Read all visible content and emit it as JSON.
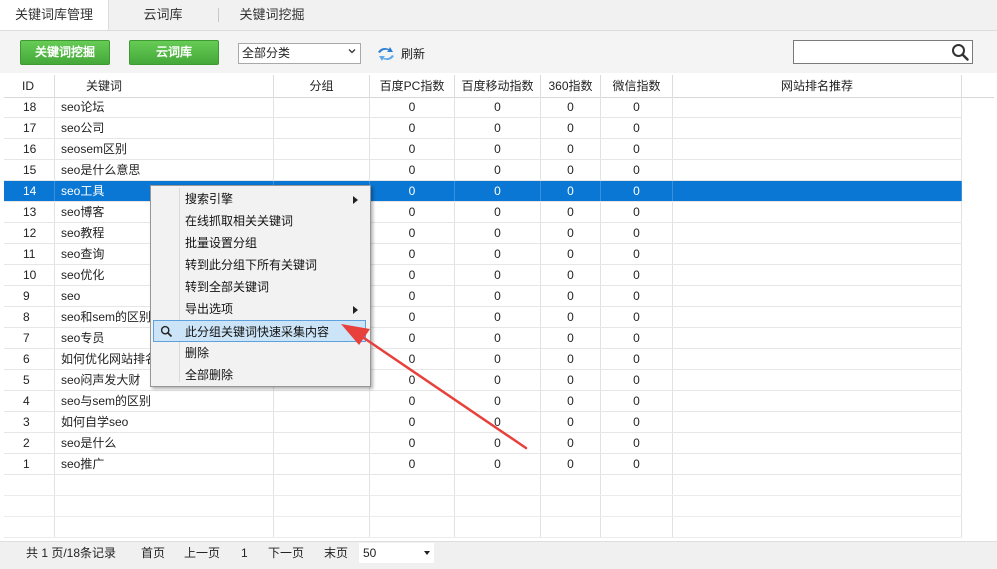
{
  "tabs": [
    "关键词库管理",
    "云词库",
    "关键词挖掘"
  ],
  "toolbar": {
    "btn_mining": "关键词挖掘",
    "btn_cloud": "云词库",
    "category_select": "全部分类",
    "refresh": "刷新",
    "search_value": ""
  },
  "columns": [
    "ID",
    "关键词",
    "分组",
    "百度PC指数",
    "百度移动指数",
    "360指数",
    "微信指数",
    "网站排名推荐"
  ],
  "rows": [
    {
      "id": "18",
      "kw": "seo论坛",
      "grp": "",
      "pc": "0",
      "mob": "0",
      "s360": "0",
      "wx": "0",
      "rec": ""
    },
    {
      "id": "17",
      "kw": "seo公司",
      "grp": "",
      "pc": "0",
      "mob": "0",
      "s360": "0",
      "wx": "0",
      "rec": ""
    },
    {
      "id": "16",
      "kw": "seosem区别",
      "grp": "",
      "pc": "0",
      "mob": "0",
      "s360": "0",
      "wx": "0",
      "rec": ""
    },
    {
      "id": "15",
      "kw": "seo是什么意思",
      "grp": "",
      "pc": "0",
      "mob": "0",
      "s360": "0",
      "wx": "0",
      "rec": ""
    },
    {
      "id": "14",
      "kw": "seo工具",
      "grp": "",
      "pc": "0",
      "mob": "0",
      "s360": "0",
      "wx": "0",
      "rec": "",
      "selected": true
    },
    {
      "id": "13",
      "kw": "seo博客",
      "grp": "",
      "pc": "0",
      "mob": "0",
      "s360": "0",
      "wx": "0",
      "rec": ""
    },
    {
      "id": "12",
      "kw": "seo教程",
      "grp": "",
      "pc": "0",
      "mob": "0",
      "s360": "0",
      "wx": "0",
      "rec": ""
    },
    {
      "id": "11",
      "kw": "seo查询",
      "grp": "",
      "pc": "0",
      "mob": "0",
      "s360": "0",
      "wx": "0",
      "rec": ""
    },
    {
      "id": "10",
      "kw": "seo优化",
      "grp": "",
      "pc": "0",
      "mob": "0",
      "s360": "0",
      "wx": "0",
      "rec": ""
    },
    {
      "id": "9",
      "kw": "seo",
      "grp": "",
      "pc": "0",
      "mob": "0",
      "s360": "0",
      "wx": "0",
      "rec": ""
    },
    {
      "id": "8",
      "kw": "seo和sem的区别",
      "grp": "",
      "pc": "0",
      "mob": "0",
      "s360": "0",
      "wx": "0",
      "rec": ""
    },
    {
      "id": "7",
      "kw": "seo专员",
      "grp": "",
      "pc": "0",
      "mob": "0",
      "s360": "0",
      "wx": "0",
      "rec": ""
    },
    {
      "id": "6",
      "kw": "如何优化网站排名",
      "grp": "",
      "pc": "0",
      "mob": "0",
      "s360": "0",
      "wx": "0",
      "rec": ""
    },
    {
      "id": "5",
      "kw": "seo闷声发大财",
      "grp": "",
      "pc": "0",
      "mob": "0",
      "s360": "0",
      "wx": "0",
      "rec": ""
    },
    {
      "id": "4",
      "kw": "seo与sem的区别",
      "grp": "",
      "pc": "0",
      "mob": "0",
      "s360": "0",
      "wx": "0",
      "rec": ""
    },
    {
      "id": "3",
      "kw": "如何自学seo",
      "grp": "",
      "pc": "0",
      "mob": "0",
      "s360": "0",
      "wx": "0",
      "rec": ""
    },
    {
      "id": "2",
      "kw": "seo是什么",
      "grp": "",
      "pc": "0",
      "mob": "0",
      "s360": "0",
      "wx": "0",
      "rec": ""
    },
    {
      "id": "1",
      "kw": "seo推广",
      "grp": "",
      "pc": "0",
      "mob": "0",
      "s360": "0",
      "wx": "0",
      "rec": ""
    }
  ],
  "context_menu": [
    {
      "label": "搜索引擎",
      "submenu": true
    },
    {
      "label": "在线抓取相关关键词"
    },
    {
      "label": "批量设置分组"
    },
    {
      "label": "转到此分组下所有关键词"
    },
    {
      "label": "转到全部关键词"
    },
    {
      "label": "导出选项",
      "submenu": true
    },
    {
      "label": "此分组关键词快速采集内容",
      "highlighted": true,
      "icon": "search-icon"
    },
    {
      "label": "删除"
    },
    {
      "label": "全部删除"
    }
  ],
  "footer": {
    "summary": "共 1 页/18条记录",
    "first": "首页",
    "prev": "上一页",
    "page": "1",
    "next": "下一页",
    "last": "末页",
    "page_size": "50"
  },
  "colors": {
    "accent_green": "#45a83a",
    "selection_blue": "#0a77d4",
    "menu_highlight": "#cce4f7",
    "annotation_arrow": "#e8403a"
  }
}
